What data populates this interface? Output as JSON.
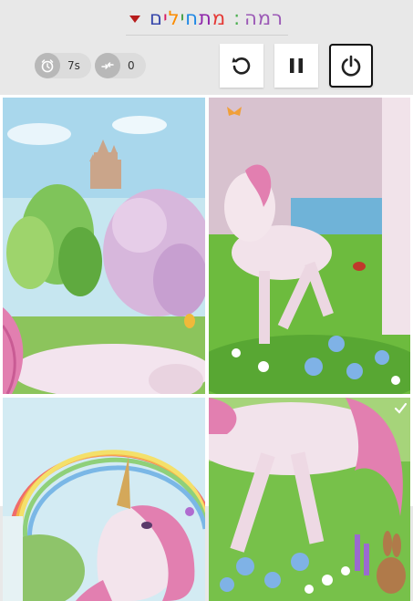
{
  "header": {
    "level_label": "רמה",
    "level_separator": ":",
    "level_name_letters": [
      "מ",
      "ת",
      "ח",
      "י",
      "ל",
      "י",
      "ם"
    ],
    "level_name_colors": [
      "#e53935",
      "#8e24aa",
      "#1e88e5",
      "#43a047",
      "#fb8c00",
      "#d81b60",
      "#3949ab"
    ],
    "level_dropdown_icon": "caret-down-icon"
  },
  "stats": {
    "timer_icon": "alarm-clock-icon",
    "timer_value": "7s",
    "moves_icon": "swap-arrows-icon",
    "moves_value": "0"
  },
  "controls": {
    "restart_icon": "restart-icon",
    "pause_icon": "pause-icon",
    "power_icon": "power-icon"
  },
  "board": {
    "tiles": [
      "castle-meadow",
      "foal-by-lake",
      "unicorn-rainbow",
      "unicorn-flowers"
    ],
    "correct_tile_marker": "checkmark-icon"
  },
  "colors": {
    "background": "#e8e8e8",
    "unicorn_pink": "#e27fb0",
    "sky": "#bfe3f2",
    "grass": "#6dbb3e"
  }
}
